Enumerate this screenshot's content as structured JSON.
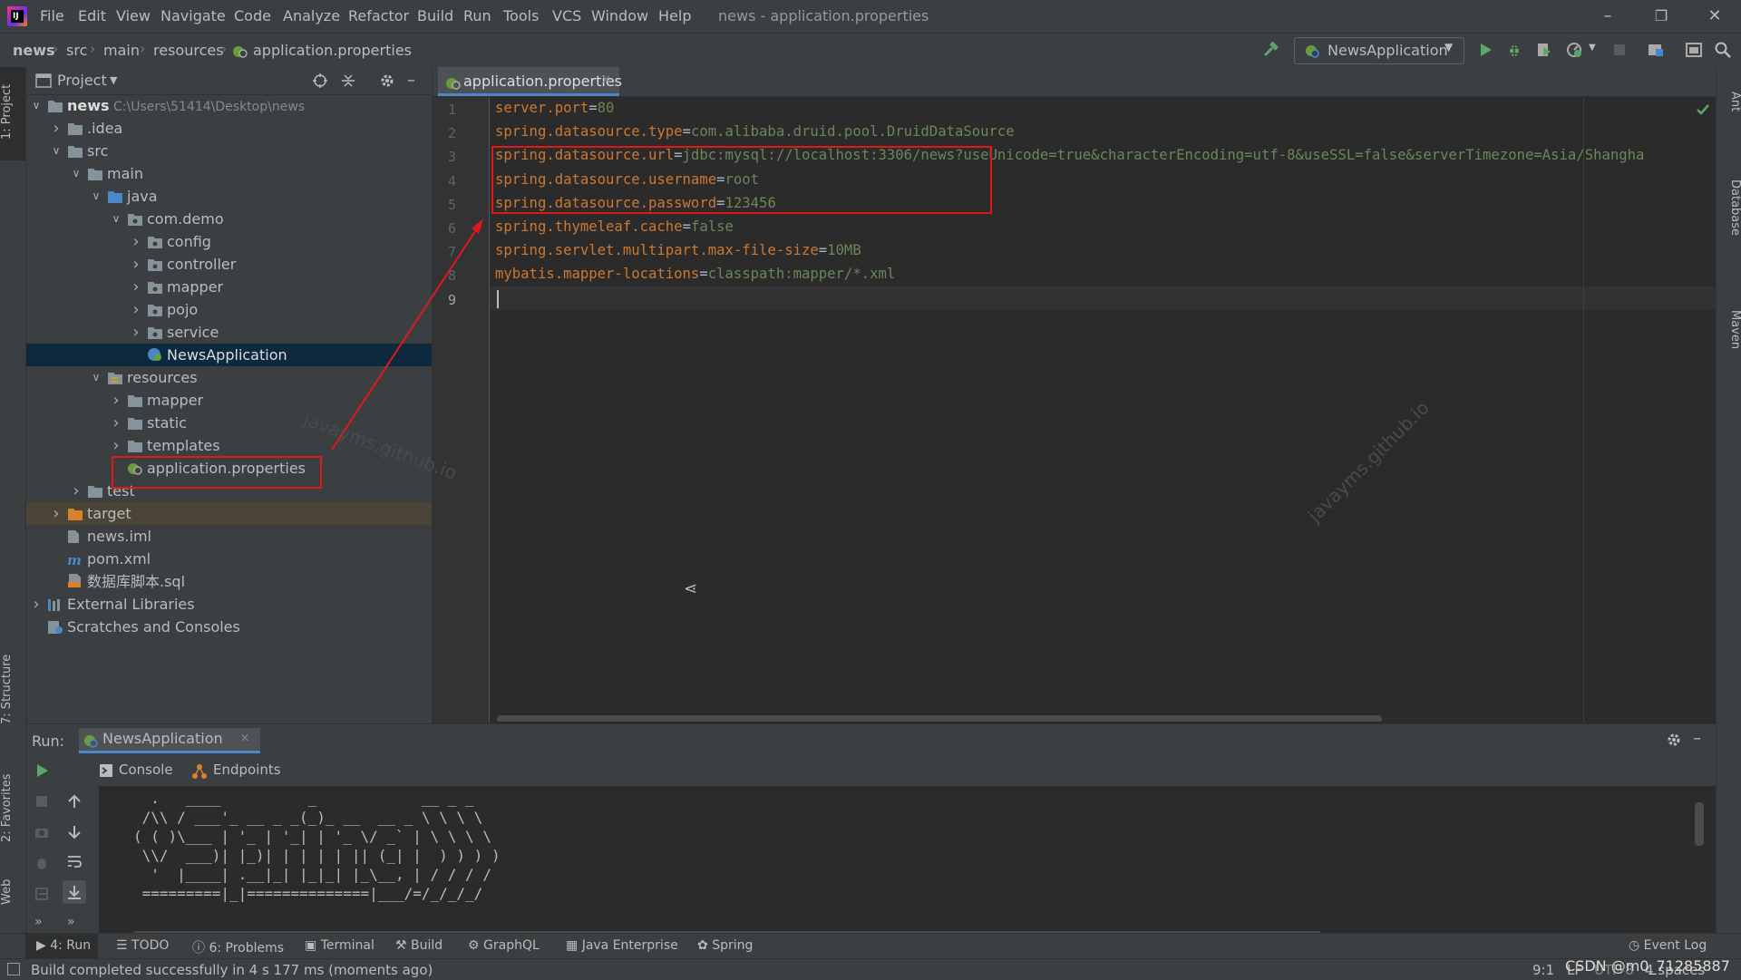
{
  "menu": {
    "items": [
      "File",
      "Edit",
      "View",
      "Navigate",
      "Code",
      "Analyze",
      "Refactor",
      "Build",
      "Run",
      "Tools",
      "VCS",
      "Window",
      "Help"
    ],
    "title": "news - application.properties"
  },
  "breadcrumb": [
    "news",
    "src",
    "main",
    "resources",
    "application.properties"
  ],
  "run_config": {
    "label": "NewsApplication"
  },
  "left_stripe": {
    "project": "1: Project",
    "structure": "7: Structure",
    "favorites": "2: Favorites",
    "web": "Web"
  },
  "right_stripe": {
    "ant": "Ant",
    "database": "Database",
    "maven": "Maven"
  },
  "project_panel": {
    "title": "Project",
    "root_name": "news",
    "root_path": "C:\\Users\\51414\\Desktop\\news",
    "tree": [
      ".idea",
      "src",
      "main",
      "java",
      "com.demo",
      "config",
      "controller",
      "mapper",
      "pojo",
      "service",
      "NewsApplication",
      "resources",
      "mapper",
      "static",
      "templates",
      "application.properties",
      "test",
      "target",
      "news.iml",
      "pom.xml",
      "数据库脚本.sql",
      "External Libraries",
      "Scratches and Consoles"
    ]
  },
  "editor": {
    "tab_label": "application.properties",
    "line_numbers": [
      "1",
      "2",
      "3",
      "4",
      "5",
      "6",
      "7",
      "8",
      "9"
    ],
    "lines": [
      {
        "key": "server.port",
        "value": "80"
      },
      {
        "key": "spring.datasource.type",
        "value": "com.alibaba.druid.pool.DruidDataSource"
      },
      {
        "key": "spring.datasource.url",
        "value": "jdbc:mysql://localhost:3306/news?useUnicode=true&characterEncoding=utf-8&useSSL=false&serverTimezone=Asia/Shangha"
      },
      {
        "key": "spring.datasource.username",
        "value": "root"
      },
      {
        "key": "spring.datasource.password",
        "value": "123456"
      },
      {
        "key": "spring.thymeleaf.cache",
        "value": "false"
      },
      {
        "key": "spring.servlet.multipart.max-file-size",
        "value": "10MB"
      },
      {
        "key": "mybatis.mapper-locations",
        "value": "classpath:mapper/*.xml"
      }
    ],
    "eq": "="
  },
  "watermark": "javayms.github.io",
  "run_panel": {
    "run_label": "Run:",
    "tab_label": "NewsApplication",
    "console_tab": "Console",
    "endpoints_tab": "Endpoints",
    "banner": [
      "  .   ____          _            __ _ _",
      " /\\\\ / ___'_ __ _ _(_)_ __  __ _ \\ \\ \\ \\",
      "( ( )\\___ | '_ | '_| | '_ \\/ _` | \\ \\ \\ \\",
      " \\\\/  ___)| |_)| | | | | || (_| |  ) ) ) )",
      "  '  |____| .__|_| |_|_| |_\\__, | / / / /",
      " =========|_|==============|___/=/_/_/_/"
    ]
  },
  "tool_strip": [
    "4: Run",
    "TODO",
    "6: Problems",
    "Terminal",
    "Build",
    "GraphQL",
    "Java Enterprise",
    "Spring"
  ],
  "event_log": "Event Log",
  "status": {
    "message": "Build completed successfully in 4 s 177 ms (moments ago)",
    "position": "9:1",
    "line_sep": "LF",
    "encoding": "UTF-8",
    "indent": "4 spaces",
    "csdn": "CSDN @m0_71285887"
  },
  "colors": {
    "key": "#cc7832",
    "value": "#6a8759",
    "annotation": "#e01818",
    "selection": "#0d293e"
  }
}
